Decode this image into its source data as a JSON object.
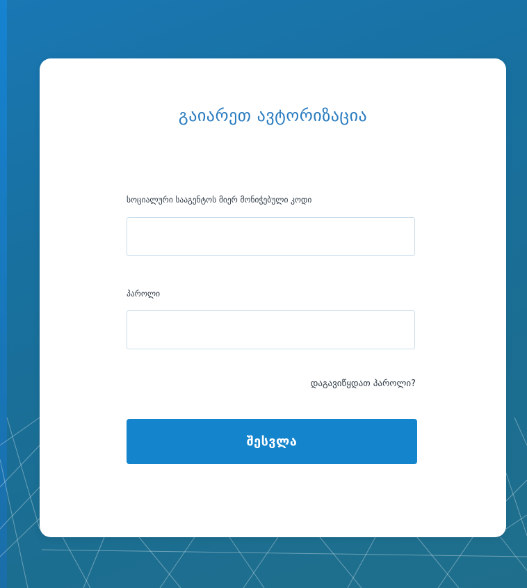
{
  "login_form": {
    "title": "გაიარეთ ავტორიზაცია",
    "code_label": "სოციალური სააგენტოს მიერ მონიჭებული კოდი",
    "code_value": "",
    "code_placeholder": "",
    "password_label": "პაროლი",
    "password_value": "",
    "password_placeholder": "",
    "forgot_password_link": "დაგავიწყდათ პაროლი?",
    "submit_label": "შესვლა"
  },
  "colors": {
    "accent": "#1484cc",
    "title": "#2a7bbf",
    "background": "#18709f",
    "card": "#ffffff"
  }
}
